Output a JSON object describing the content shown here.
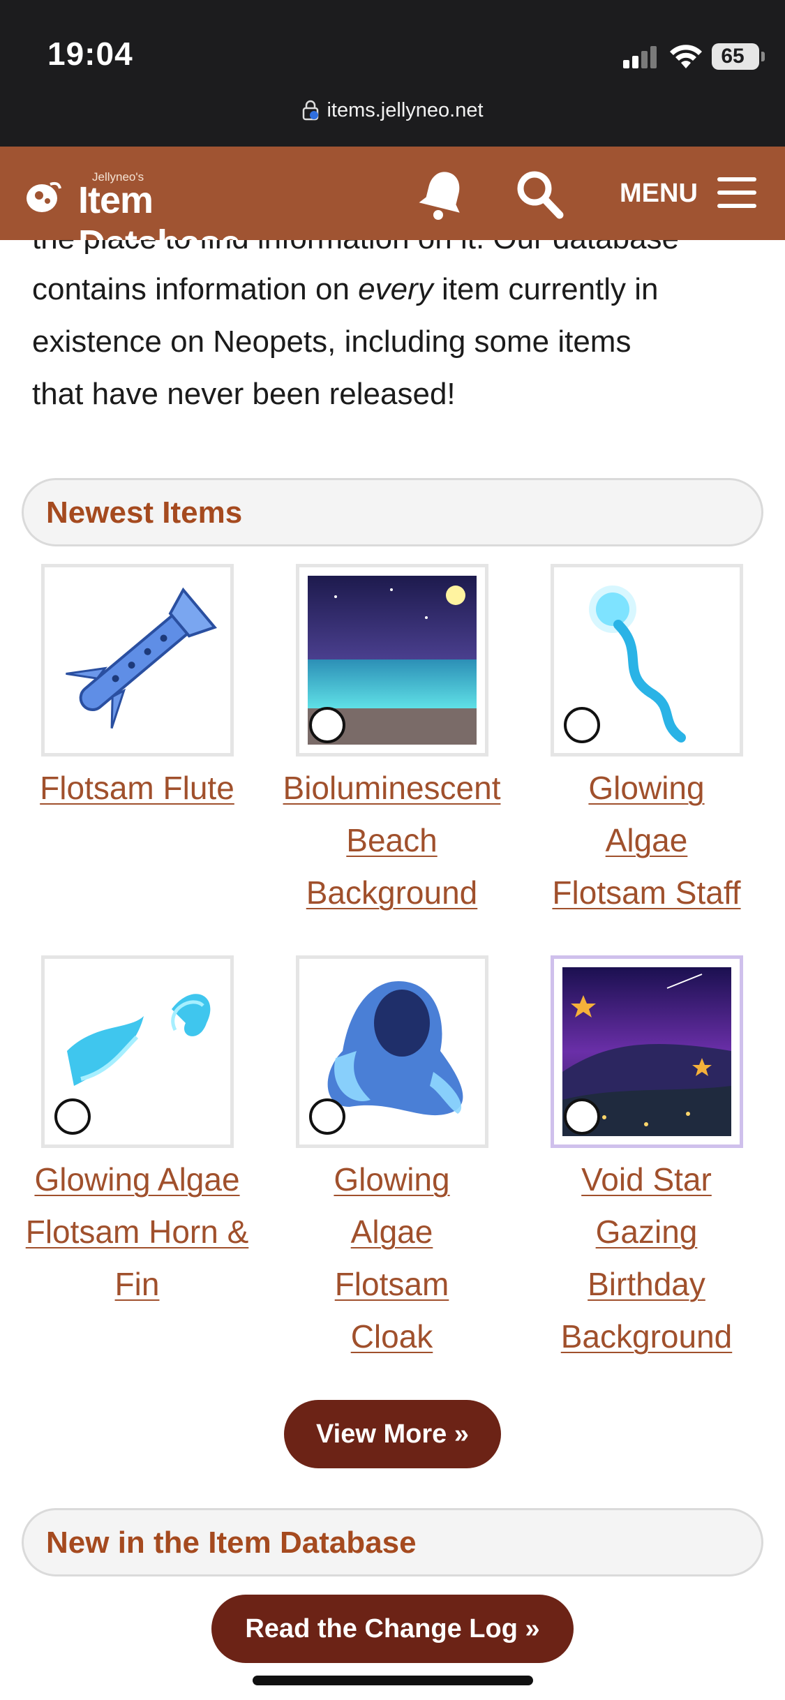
{
  "status_bar": {
    "time": "19:04",
    "battery": "65",
    "url": "items.jellyneo.net"
  },
  "header": {
    "logo_small": "Jellyneo's",
    "logo_text": "Item Database",
    "bell_icon": "bell-icon",
    "search_icon": "search-icon",
    "menu_label": "MENU"
  },
  "intro": {
    "cut_line": "the place to find information on it. Our database",
    "line1_before": "contains information on ",
    "line1_emph": "every",
    "line1_after": " item currently in",
    "line2": "existence on Neopets, including some items",
    "line3": "that have never been released!"
  },
  "newest": {
    "title": "Newest Items",
    "items": [
      {
        "name": "Flotsam Flute",
        "wearable": false
      },
      {
        "name": "Bioluminescent Beach Background",
        "wearable": true
      },
      {
        "name": "Glowing Algae Flotsam Staff",
        "wearable": true
      },
      {
        "name": "Glowing Algae Flotsam Horn & Fin",
        "wearable": true
      },
      {
        "name": "Glowing Algae Flotsam Cloak",
        "wearable": true
      },
      {
        "name": "Void Star Gazing Birthday Background",
        "wearable": true
      }
    ],
    "view_more": "View More »"
  },
  "changelog": {
    "title": "New in the Item Database",
    "button": "Read the Change Log »"
  },
  "colors": {
    "brand": "#a05432",
    "link": "#a0502c",
    "button": "#6c2316"
  }
}
